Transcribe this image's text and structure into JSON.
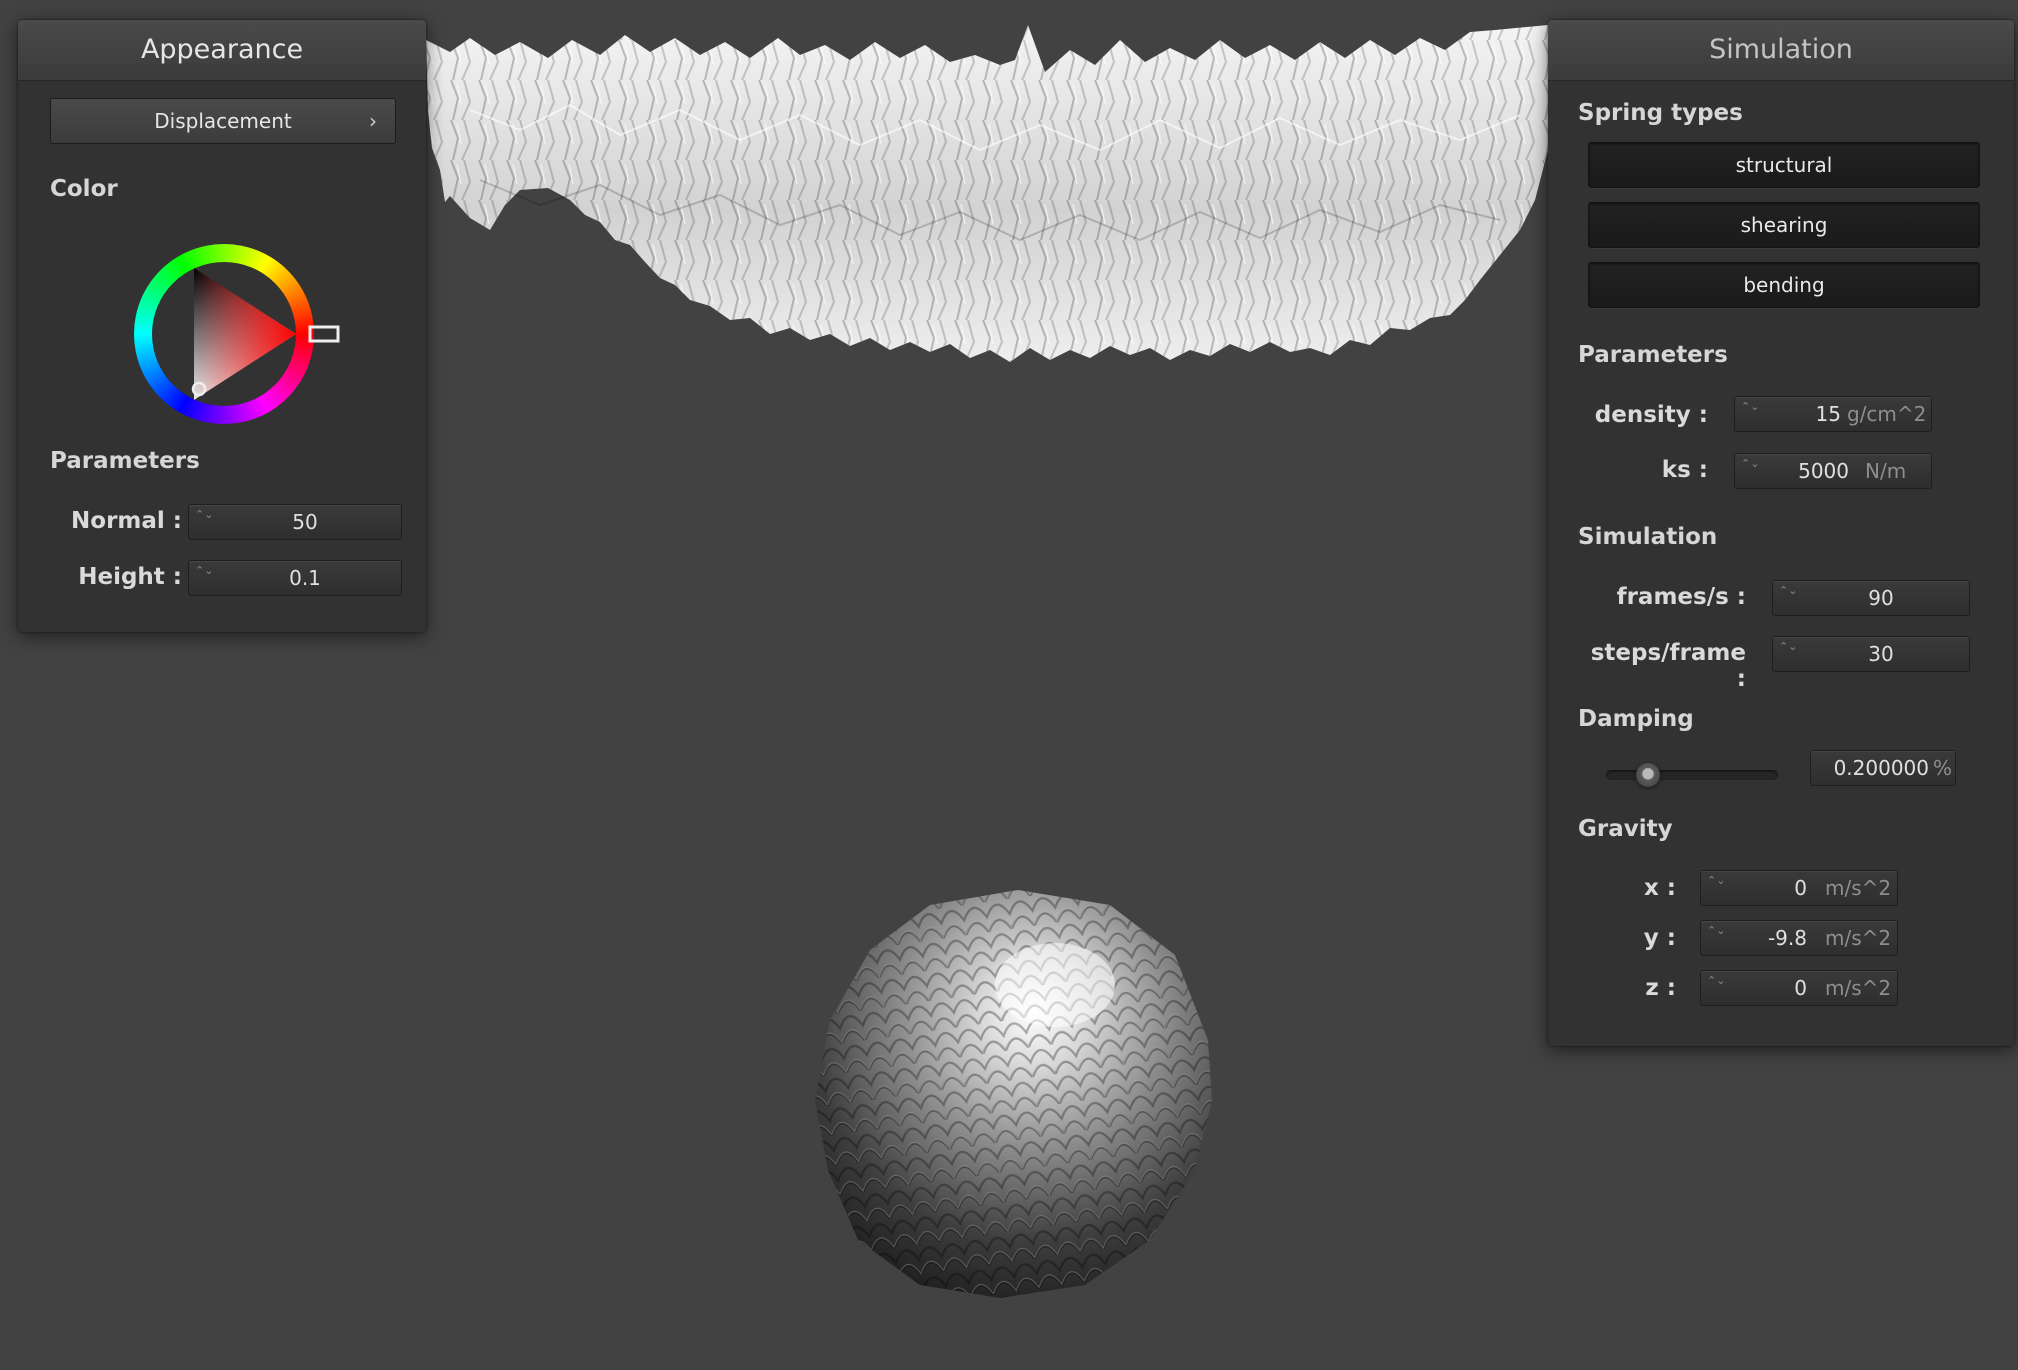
{
  "appearance": {
    "title": "Appearance",
    "texture_button": "Displacement",
    "chevron_glyph": "›",
    "color_label": "Color",
    "wheel_color": "#ff0000",
    "params_label": "Parameters",
    "normal": {
      "label": "Normal :",
      "value": "50"
    },
    "height": {
      "label": "Height :",
      "value": "0.1"
    }
  },
  "simulation": {
    "title": "Simulation",
    "spring_types_label": "Spring types",
    "springs": [
      {
        "label": "structural"
      },
      {
        "label": "shearing"
      },
      {
        "label": "bending"
      }
    ],
    "params_label": "Parameters",
    "density": {
      "label": "density :",
      "value": "15",
      "unit": "g/cm^2"
    },
    "ks": {
      "label": "ks :",
      "value": "5000",
      "unit": "N/m"
    },
    "sim_label": "Simulation",
    "fps": {
      "label": "frames/s :",
      "value": "90"
    },
    "steps": {
      "label": "steps/frame :",
      "value": "30"
    },
    "damping_label": "Damping",
    "damping": {
      "value": "0.200000",
      "unit": "%",
      "slider_fraction": 0.2
    },
    "gravity_label": "Gravity",
    "gx": {
      "label": "x :",
      "value": "0",
      "unit": "m/s^2"
    },
    "gy": {
      "label": "y :",
      "value": "-9.8",
      "unit": "m/s^2"
    },
    "gz": {
      "label": "z :",
      "value": "0",
      "unit": "m/s^2"
    }
  },
  "icons": {
    "spin_arrows": "⌃⌄"
  }
}
